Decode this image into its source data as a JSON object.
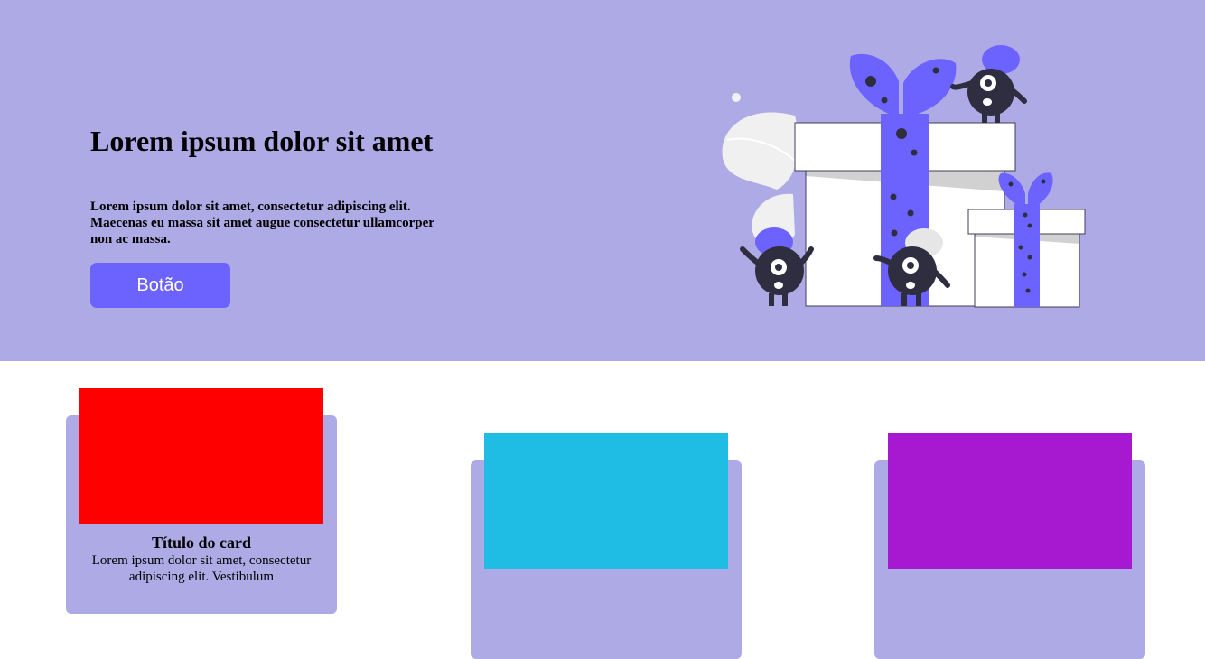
{
  "hero": {
    "title": "Lorem ipsum dolor sit amet",
    "text": "Lorem ipsum dolor sit amet, consectetur adipiscing elit. Maecenas eu massa sit amet augue consectetur ullamcorper non ac massa.",
    "button_label": "Botão",
    "illustration_icon": "gift-boxes-with-monsters-illustration"
  },
  "colors": {
    "hero_background": "#adaae5",
    "button": "#6c63ff",
    "card_background": "#adaae5"
  },
  "cards": [
    {
      "image_color": "#ff0000",
      "title": "Título do card",
      "text": "Lorem ipsum dolor sit amet, consectetur adipiscing elit. Vestibulum"
    },
    {
      "image_color": "#1fbde3"
    },
    {
      "image_color": "#a619d1"
    }
  ]
}
